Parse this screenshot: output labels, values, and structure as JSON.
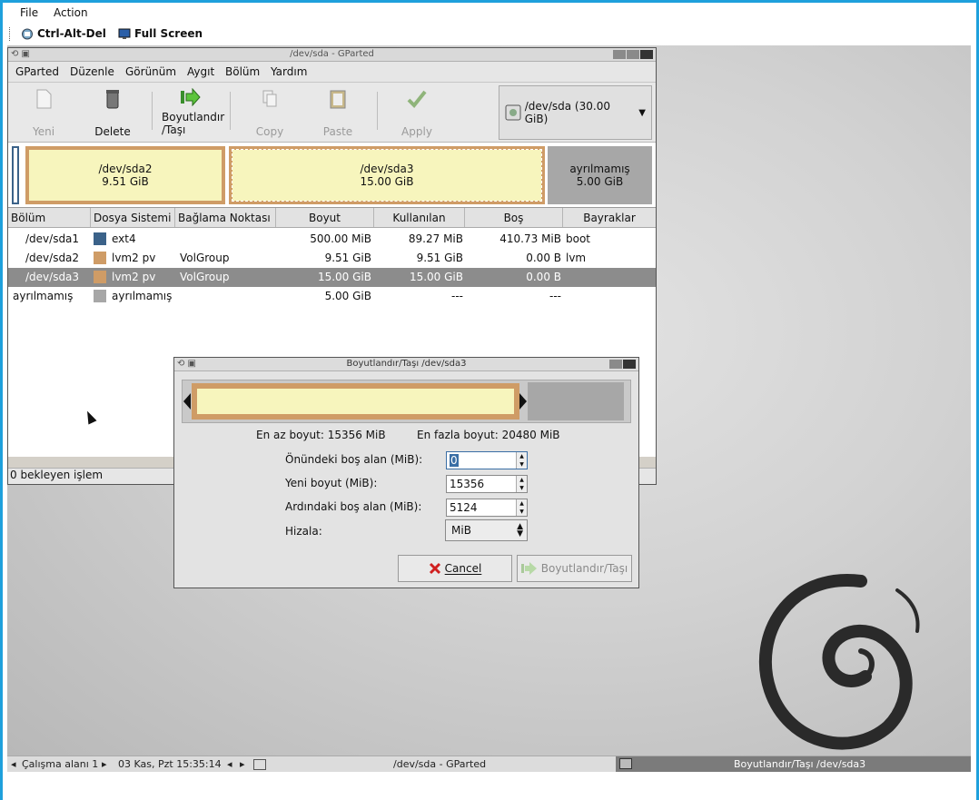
{
  "host": {
    "menu": [
      "File",
      "Action"
    ],
    "toolbar": {
      "cad": "Ctrl-Alt-Del",
      "fullscreen": "Full Screen"
    }
  },
  "main_window": {
    "title": "/dev/sda - GParted",
    "menu": [
      "GParted",
      "Düzenle",
      "Görünüm",
      "Aygıt",
      "Bölüm",
      "Yardım"
    ],
    "tools": {
      "new": "Yeni",
      "delete": "Delete",
      "resize": "Boyutlandır\n/Taşı",
      "copy": "Copy",
      "paste": "Paste",
      "apply": "Apply"
    },
    "device": "/dev/sda  (30.00 GiB)",
    "diskmap": {
      "sda2_name": "/dev/sda2",
      "sda2_size": "9.51 GiB",
      "sda3_name": "/dev/sda3",
      "sda3_size": "15.00 GiB",
      "unalloc_name": "ayrılmamış",
      "unalloc_size": "5.00 GiB"
    },
    "columns": [
      "Bölüm",
      "Dosya Sistemi",
      "Bağlama Noktası",
      "Boyut",
      "Kullanılan",
      "Boş",
      "Bayraklar"
    ],
    "rows": [
      {
        "part": "/dev/sda1",
        "fs": "ext4",
        "mount": "",
        "size": "500.00 MiB",
        "used": "89.27 MiB",
        "free": "410.73 MiB",
        "flags": "boot",
        "color": "#3b6289"
      },
      {
        "part": "/dev/sda2",
        "fs": "lvm2 pv",
        "mount": "VolGroup",
        "size": "9.51 GiB",
        "used": "9.51 GiB",
        "free": "0.00 B",
        "flags": "lvm",
        "color": "#cf9c66"
      },
      {
        "part": "/dev/sda3",
        "fs": "lvm2 pv",
        "mount": "VolGroup",
        "size": "15.00 GiB",
        "used": "15.00 GiB",
        "free": "0.00 B",
        "flags": "",
        "color": "#cf9c66"
      },
      {
        "part": "ayrılmamış",
        "fs": "ayrılmamış",
        "mount": "",
        "size": "5.00 GiB",
        "used": "---",
        "free": "---",
        "flags": "",
        "color": "#a7a7a7"
      }
    ],
    "status": "0 bekleyen işlem"
  },
  "dialog": {
    "title": "Boyutlandır/Taşı /dev/sda3",
    "min_size": "En az boyut: 15356 MiB",
    "max_size": "En fazla boyut: 20480 MiB",
    "free_before_label": "Önündeki boş alan (MiB):",
    "free_before": "0",
    "new_size_label": "Yeni boyut (MiB):",
    "new_size": "15356",
    "free_after_label": "Ardındaki boş alan (MiB):",
    "free_after": "5124",
    "align_label": "Hizala:",
    "align": "MiB",
    "cancel": "Cancel",
    "ok": "Boyutlandır/Taşı"
  },
  "panel": {
    "workspace": "Çalışma alanı 1",
    "clock": "03 Kas, Pzt 15:35:14",
    "task1": "/dev/sda - GParted",
    "task2": "Boyutlandır/Taşı /dev/sda3"
  },
  "colors": {
    "lvm": "#cf9c66",
    "ext4": "#3b6289",
    "unallocated": "#a7a7a7",
    "partition_fill": "#f7f5bd",
    "selection": "#8c8c8c"
  }
}
